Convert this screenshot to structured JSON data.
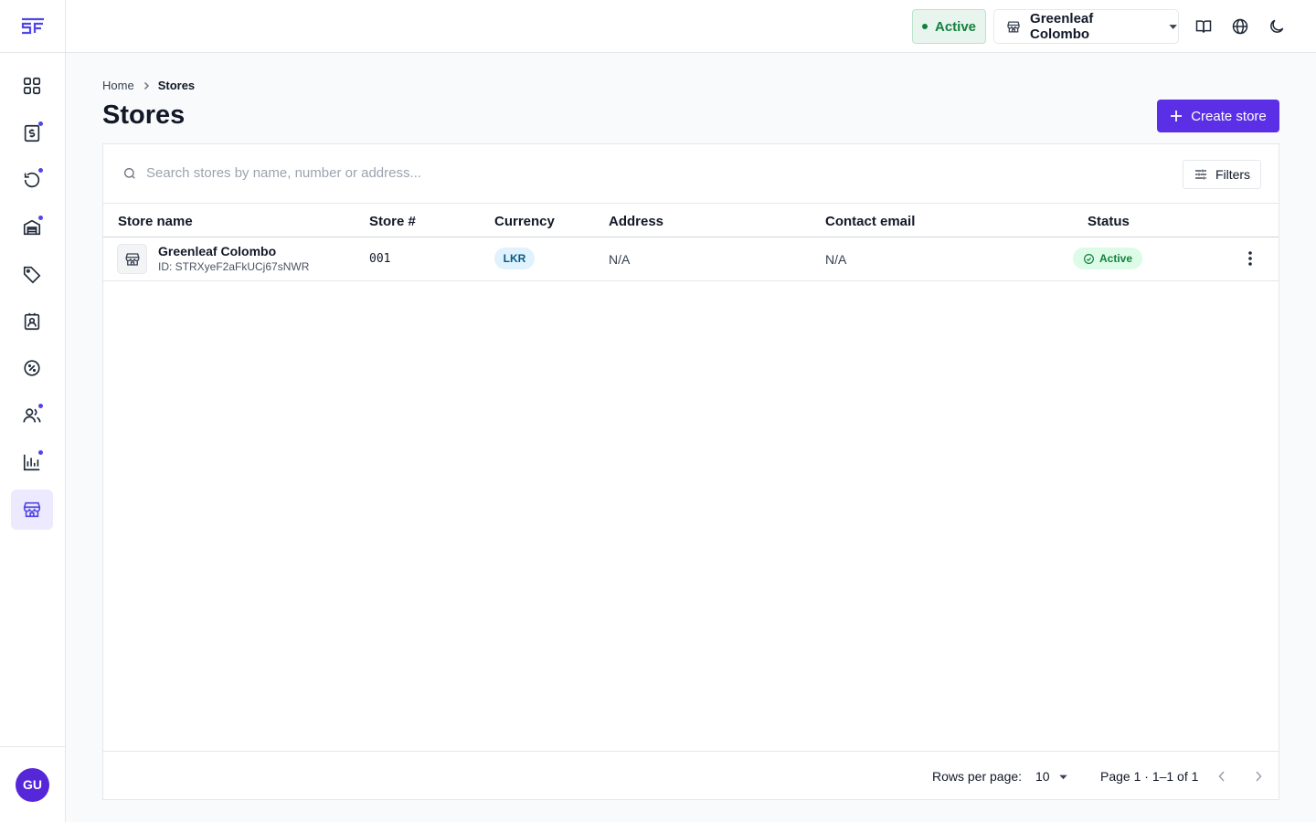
{
  "app": {
    "logo": "SF",
    "user_initials": "GU"
  },
  "sidebar": {
    "items": [
      {
        "icon": "dashboard-grid-icon",
        "dot": false,
        "active": false
      },
      {
        "icon": "receipt-dollar-icon",
        "dot": true,
        "active": false
      },
      {
        "icon": "history-refresh-icon",
        "dot": true,
        "active": false
      },
      {
        "icon": "warehouse-icon",
        "dot": true,
        "active": false
      },
      {
        "icon": "tag-icon",
        "dot": false,
        "active": false
      },
      {
        "icon": "contact-badge-icon",
        "dot": false,
        "active": false
      },
      {
        "icon": "discount-badge-icon",
        "dot": false,
        "active": false
      },
      {
        "icon": "users-icon",
        "dot": true,
        "active": false
      },
      {
        "icon": "bar-chart-icon",
        "dot": true,
        "active": false
      },
      {
        "icon": "store-icon",
        "dot": false,
        "active": true
      }
    ]
  },
  "topbar": {
    "status_label": "Active",
    "store_name": "Greenleaf Colombo",
    "icons": [
      "book-icon",
      "globe-icon",
      "moon-icon"
    ]
  },
  "breadcrumb": {
    "home": "Home",
    "current": "Stores"
  },
  "page": {
    "title": "Stores",
    "create_label": "Create store"
  },
  "search": {
    "placeholder": "Search stores by name, number or address...",
    "value": ""
  },
  "filters_label": "Filters",
  "table": {
    "columns": {
      "store_name": "Store name",
      "store_number": "Store #",
      "currency": "Currency",
      "address": "Address",
      "contact_email": "Contact email",
      "status": "Status"
    },
    "rows": [
      {
        "name": "Greenleaf Colombo",
        "id": "ID: STRXyeF2aFkUCj67sNWR",
        "number": "001",
        "currency": "LKR",
        "address": "N/A",
        "email": "N/A",
        "status": "Active"
      }
    ]
  },
  "footer": {
    "rows_per_page_label": "Rows per page:",
    "rows_per_page_value": "10",
    "page_info": "Page 1 · 1–1 of 1"
  },
  "colors": {
    "accent": "#5b2fe6",
    "success": "#15803d"
  }
}
